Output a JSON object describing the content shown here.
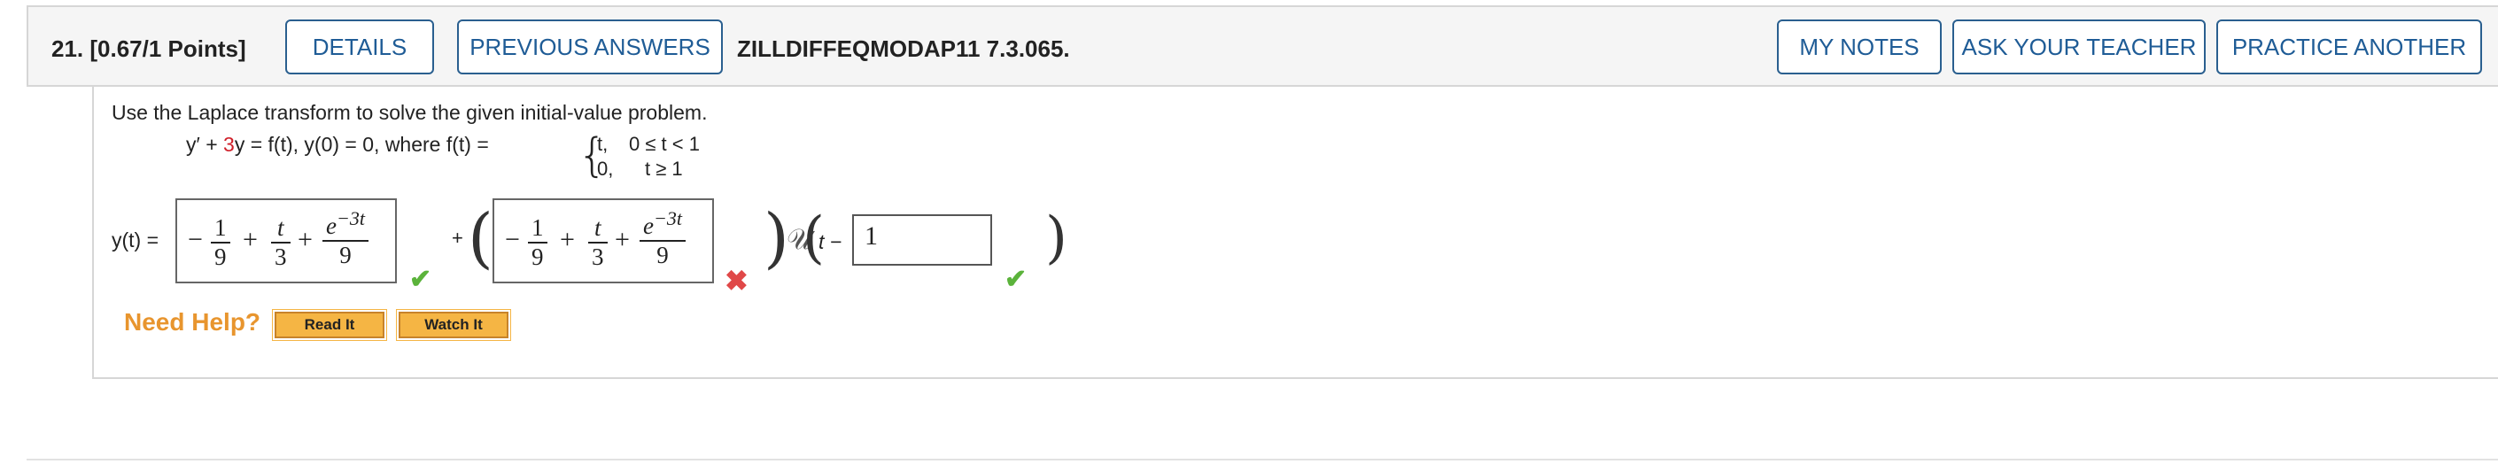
{
  "header": {
    "question_label": "21. [0.67/1 Points]",
    "details_label": "DETAILS",
    "previous_answers_label": "PREVIOUS ANSWERS",
    "assignment_id": "ZILLDIFFEQMODAP11 7.3.065.",
    "my_notes_label": "MY NOTES",
    "ask_teacher_label": "ASK YOUR TEACHER",
    "practice_another_label": "PRACTICE ANOTHER"
  },
  "problem": {
    "instructions": "Use the Laplace transform to solve the given initial-value problem.",
    "equation_lhs": "y′ + ",
    "equation_coeff": "3",
    "equation_rest": "y = f(t),    y(0) = 0, where f(t) =",
    "case1_value": "t,",
    "case1_condition": "0 ≤ t < 1",
    "case2_value": "0,",
    "case2_condition": "t ≥ 1"
  },
  "answer": {
    "label": "y(t) =",
    "box1": {
      "minus": "−",
      "f1_num": "1",
      "f1_den": "9",
      "plus1": "+",
      "f2_num": "t",
      "f2_den": "3",
      "plus2": "+",
      "f3_num": "e",
      "f3_exp": "−3t",
      "f3_den": "9"
    },
    "plus_between": "+",
    "box2": {
      "minus": "−",
      "f1_num": "1",
      "f1_den": "9",
      "plus1": "+",
      "f2_num": "t",
      "f2_den": "3",
      "plus2": "+",
      "f3_num": "e",
      "f3_exp": "−3t",
      "f3_den": "9"
    },
    "unit_step": "𝒰",
    "step_arg": "t −",
    "shift_value": "1",
    "box1_status": "correct",
    "box2_status": "incorrect",
    "shift_status": "correct"
  },
  "help": {
    "label": "Need Help?",
    "read_it_label": "Read It",
    "watch_it_label": "Watch It"
  },
  "colors": {
    "button_border": "#2a5f8f",
    "button_text": "#1f5c96",
    "help_orange": "#e8952e",
    "check_green": "#5bb33b",
    "cross_red": "#e04848"
  }
}
